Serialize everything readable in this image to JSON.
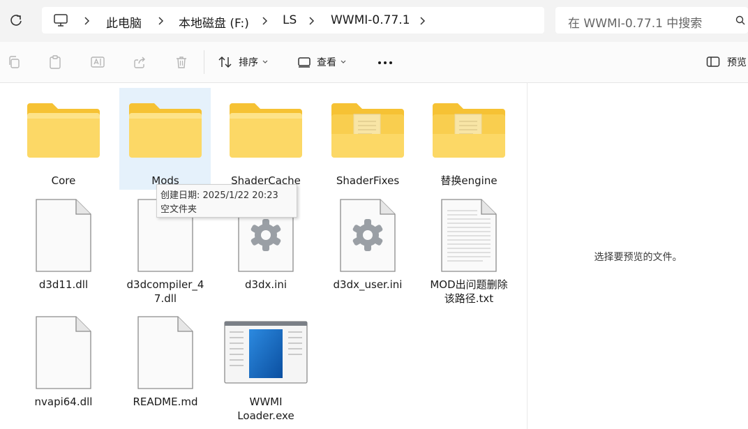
{
  "address_bar": {
    "crumbs": [
      "此电脑",
      "本地磁盘 (F:)",
      "LS",
      "WWMI-0.77.1"
    ],
    "search_placeholder": "在 WWMI-0.77.1 中搜索"
  },
  "toolbar": {
    "sort_label": "排序",
    "view_label": "查看",
    "preview_label": "预览"
  },
  "files": [
    {
      "name": "Core",
      "type": "folder"
    },
    {
      "name": "Mods",
      "type": "folder"
    },
    {
      "name": "ShaderCache",
      "type": "folder"
    },
    {
      "name": "ShaderFixes",
      "type": "folder-docs"
    },
    {
      "name": "替换engine",
      "type": "folder-docs"
    },
    {
      "name": "d3d11.dll",
      "type": "file"
    },
    {
      "name": "d3dcompiler_47.dll",
      "label_lines": [
        "d3dcompiler_4",
        "7.dll"
      ],
      "type": "file"
    },
    {
      "name": "d3dx.ini",
      "type": "config"
    },
    {
      "name": "d3dx_user.ini",
      "type": "config"
    },
    {
      "name": "MOD出问题删除该路径.txt",
      "label_lines": [
        "MOD出问题删除",
        "该路径.txt"
      ],
      "type": "text"
    },
    {
      "name": "nvapi64.dll",
      "type": "file"
    },
    {
      "name": "README.md",
      "type": "file"
    },
    {
      "name": "WWMI Loader.exe",
      "label_lines": [
        "WWMI",
        "Loader.exe"
      ],
      "type": "exe"
    }
  ],
  "tooltip": {
    "line1": "创建日期: 2025/1/22 20:23",
    "line2": "空文件夹"
  },
  "preview_pane": {
    "message": "选择要预览的文件。"
  }
}
